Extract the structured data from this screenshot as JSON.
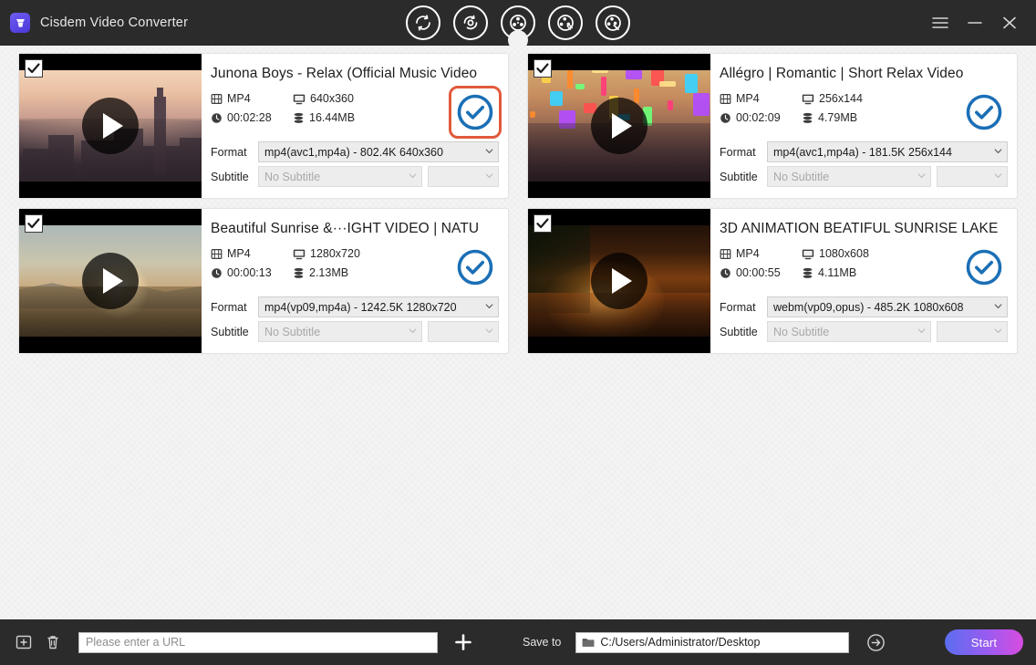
{
  "window": {
    "title": "Cisdem Video Converter",
    "logo_icon": "cisdem-logo-icon",
    "controls": [
      {
        "name": "menu-button",
        "icon": "hamburger-icon"
      },
      {
        "name": "minimize-button",
        "icon": "minimize-icon"
      },
      {
        "name": "close-button",
        "icon": "close-icon"
      }
    ]
  },
  "toolbar": {
    "items": [
      {
        "name": "convert-tab",
        "icon": "convert-circle-icon",
        "active": false
      },
      {
        "name": "download-tab",
        "icon": "download-circle-icon",
        "active": false
      },
      {
        "name": "video-tab",
        "icon": "film-reel-icon",
        "active": true
      },
      {
        "name": "edit-tab",
        "icon": "film-reel-edit-icon",
        "active": false
      },
      {
        "name": "tools-tab",
        "icon": "film-reel-tools-icon",
        "active": false
      }
    ]
  },
  "list": {
    "cards": [
      {
        "title": "Junona Boys - Relax (Official Music Video",
        "checked": true,
        "thumb_scene": "scene-city",
        "format_label": "MP4",
        "resolution": "640x360",
        "duration": "00:02:28",
        "filesize": "16.44MB",
        "format_row_label": "Format",
        "format_value": "mp4(avc1,mp4a) - 802.4K 640x360",
        "subtitle_row_label": "Subtitle",
        "subtitle_value": "No Subtitle",
        "status_icon": "check-circle-icon",
        "highlighted": true
      },
      {
        "title": "Allégro | Romantic | Short Relax Video",
        "checked": true,
        "thumb_scene": "scene-street",
        "format_label": "MP4",
        "resolution": "256x144",
        "duration": "00:02:09",
        "filesize": "4.79MB",
        "format_row_label": "Format",
        "format_value": "mp4(avc1,mp4a) - 181.5K 256x144",
        "subtitle_row_label": "Subtitle",
        "subtitle_value": "No Subtitle",
        "status_icon": "check-circle-icon",
        "highlighted": false
      },
      {
        "title": "Beautiful Sunrise &···IGHT VIDEO | NATU",
        "checked": true,
        "thumb_scene": "scene-sunrise",
        "format_label": "MP4",
        "resolution": "1280x720",
        "duration": "00:00:13",
        "filesize": "2.13MB",
        "format_row_label": "Format",
        "format_value": "mp4(vp09,mp4a) - 1242.5K 1280x720",
        "subtitle_row_label": "Subtitle",
        "subtitle_value": "No Subtitle",
        "status_icon": "check-circle-icon",
        "highlighted": false
      },
      {
        "title": "3D ANIMATION BEATIFUL SUNRISE LAKE",
        "checked": true,
        "thumb_scene": "scene-lake",
        "format_label": "MP4",
        "resolution": "1080x608",
        "duration": "00:00:55",
        "filesize": "4.11MB",
        "format_row_label": "Format",
        "format_value": "webm(vp09,opus) - 485.2K 1080x608",
        "subtitle_row_label": "Subtitle",
        "subtitle_value": "No Subtitle",
        "status_icon": "check-circle-icon",
        "highlighted": false
      }
    ]
  },
  "footer": {
    "add_icon": "add-box-icon",
    "delete_icon": "trash-icon",
    "url_placeholder": "Please enter a URL",
    "url_value": "",
    "add_url_icon": "plus-icon",
    "save_to_label": "Save to",
    "save_path": "C:/Users/Administrator/Desktop",
    "folder_icon": "folder-icon",
    "go_icon": "arrow-right-circle-icon",
    "start_label": "Start",
    "accent_gradient_from": "#5b6ef0",
    "accent_gradient_to": "#d94ce0"
  }
}
